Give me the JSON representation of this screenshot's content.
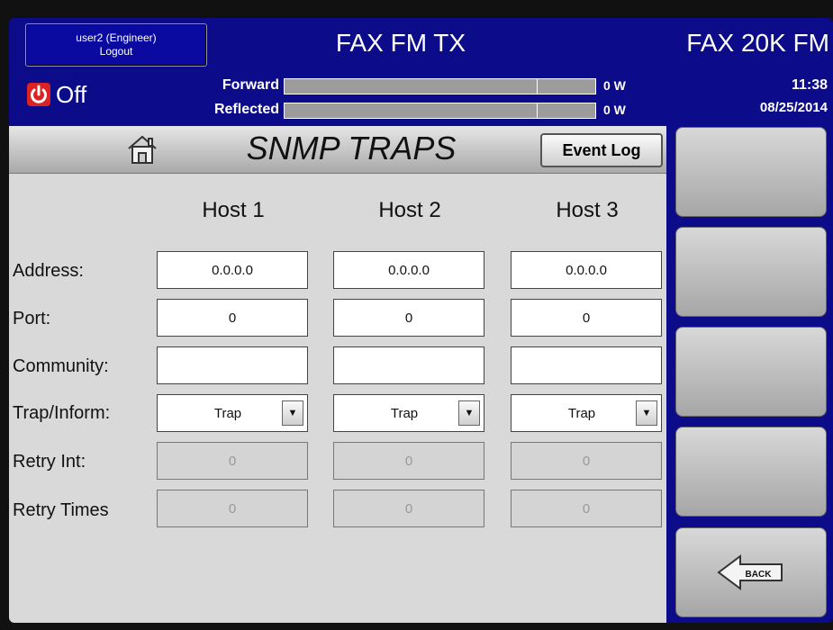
{
  "header": {
    "user_line1": "user2 (Engineer)",
    "user_line2": "Logout",
    "title": "FAX FM TX",
    "model": "FAX 20K FM"
  },
  "status": {
    "power_label": "Off",
    "forward_label": "Forward",
    "reflected_label": "Reflected",
    "forward_value": "0 W",
    "reflected_value": "0 W",
    "forward_level": 0,
    "reflected_level": 0,
    "time": "11:38",
    "date": "08/25/2014"
  },
  "page": {
    "title": "SNMP TRAPS",
    "event_log_label": "Event Log"
  },
  "hosts": [
    "Host 1",
    "Host 2",
    "Host 3"
  ],
  "rows": {
    "address_label": "Address:",
    "port_label": "Port:",
    "community_label": "Community:",
    "trap_label": "Trap/Inform:",
    "retry_int_label": "Retry Int:",
    "retry_times_label": "Retry Times"
  },
  "values": {
    "address": [
      "0.0.0.0",
      "0.0.0.0",
      "0.0.0.0"
    ],
    "port": [
      "0",
      "0",
      "0"
    ],
    "community": [
      "",
      "",
      ""
    ],
    "trap": [
      "Trap",
      "Trap",
      "Trap"
    ],
    "retry_int": [
      "0",
      "0",
      "0"
    ],
    "retry_times": [
      "0",
      "0",
      "0"
    ]
  },
  "side": {
    "back_label": "BACK"
  },
  "colors": {
    "frame": "#0c0c8a",
    "content_bg": "#d9d9d9",
    "power_red": "#dd2222"
  }
}
